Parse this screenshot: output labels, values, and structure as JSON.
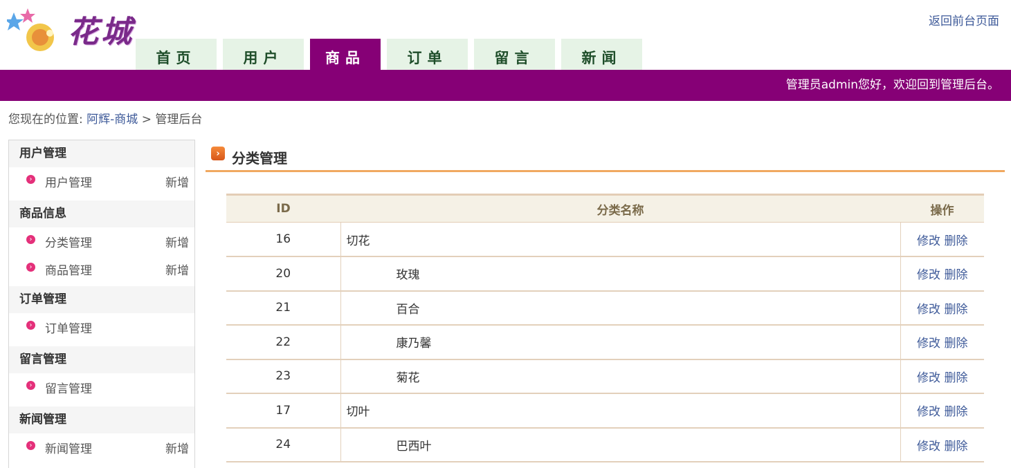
{
  "header": {
    "logo_text": "花城",
    "back_link": "返回前台页面",
    "nav": [
      "首页",
      "用户",
      "商品",
      "订单",
      "留言",
      "新闻"
    ],
    "active_nav": "商品"
  },
  "banner": {
    "welcome": "管理员admin您好，欢迎回到管理后台。"
  },
  "breadcrumb": {
    "prefix": "您现在的位置:",
    "link": "阿辉-商城",
    "separator": ">",
    "current": "管理后台"
  },
  "sidebar": [
    {
      "title": "用户管理",
      "items": [
        {
          "label": "用户管理",
          "add": "新增"
        }
      ]
    },
    {
      "title": "商品信息",
      "items": [
        {
          "label": "分类管理",
          "add": "新增"
        },
        {
          "label": "商品管理",
          "add": "新增"
        }
      ]
    },
    {
      "title": "订单管理",
      "items": [
        {
          "label": "订单管理",
          "add": ""
        }
      ]
    },
    {
      "title": "留言管理",
      "items": [
        {
          "label": "留言管理",
          "add": ""
        }
      ]
    },
    {
      "title": "新闻管理",
      "items": [
        {
          "label": "新闻管理",
          "add": "新增"
        }
      ]
    }
  ],
  "main": {
    "title": "分类管理",
    "columns": [
      "ID",
      "分类名称",
      "操作"
    ],
    "rows": [
      {
        "id": "16",
        "name": "切花",
        "child": false,
        "edit": "修改",
        "delete": "删除"
      },
      {
        "id": "20",
        "name": "玫瑰",
        "child": true,
        "edit": "修改",
        "delete": "删除"
      },
      {
        "id": "21",
        "name": "百合",
        "child": true,
        "edit": "修改",
        "delete": "删除"
      },
      {
        "id": "22",
        "name": "康乃馨",
        "child": true,
        "edit": "修改",
        "delete": "删除"
      },
      {
        "id": "23",
        "name": "菊花",
        "child": true,
        "edit": "修改",
        "delete": "删除"
      },
      {
        "id": "17",
        "name": "切叶",
        "child": false,
        "edit": "修改",
        "delete": "删除"
      },
      {
        "id": "24",
        "name": "巴西叶",
        "child": true,
        "edit": "修改",
        "delete": "删除"
      }
    ]
  }
}
